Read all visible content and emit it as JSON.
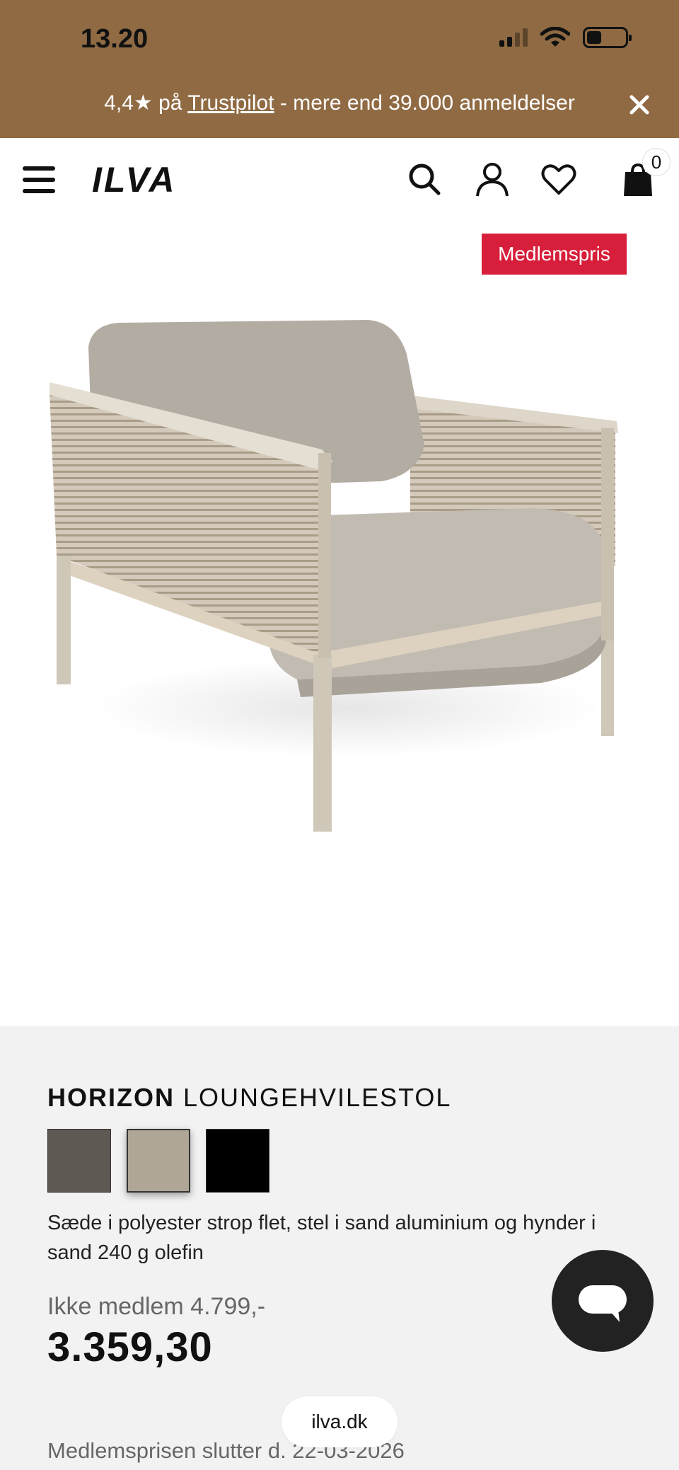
{
  "status_bar": {
    "time": "13.20"
  },
  "promo": {
    "rating": "4,4★ på ",
    "link": "Trustpilot",
    "rest": " - mere end 39.000 anmeldelser"
  },
  "header": {
    "logo": "ILVA",
    "cart_count": "0"
  },
  "product": {
    "badge": "Medlemspris",
    "name_bold": "HORIZON",
    "name_rest": " LOUNGEHVILESTOL",
    "description": "Sæde i polyester strop flet, stel i sand aluminium og hynder i sand 240 g olefin",
    "non_member_price": "Ikke medlem 4.799,-",
    "member_price": "3.359,30",
    "member_price_ends": "Medlemsprisen slutter d. 22-03-2026"
  },
  "swatch_colors": [
    "#5f5953",
    "#afa697",
    "#000000"
  ],
  "colors": {
    "topband": "#8f6a43",
    "badge": "#d71e3a"
  },
  "gallery": {
    "thumbnail_count": 4,
    "scroll_progress": 0.33
  },
  "browser": {
    "url": "ilva.dk"
  }
}
